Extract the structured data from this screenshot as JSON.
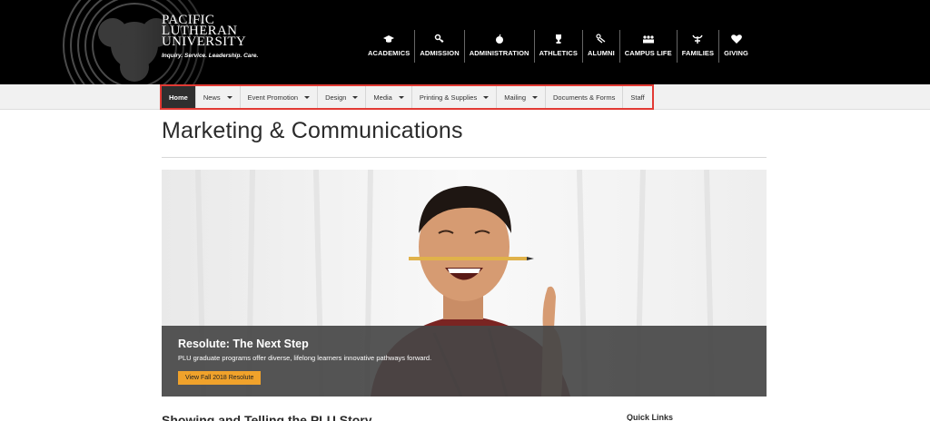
{
  "header": {
    "logo_lines": [
      "PACIFIC",
      "LUTHERAN",
      "UNIVERSITY"
    ],
    "tagline": "Inquiry. Service. Leadership. Care.",
    "nav": [
      {
        "label": "ACADEMICS",
        "icon": "graduation-cap-icon"
      },
      {
        "label": "ADMISSION",
        "icon": "key-icon"
      },
      {
        "label": "ADMINISTRATION",
        "icon": "apple-icon"
      },
      {
        "label": "ATHLETICS",
        "icon": "trophy-icon"
      },
      {
        "label": "ALUMNI",
        "icon": "handshake-icon"
      },
      {
        "label": "CAMPUS LIFE",
        "icon": "people-icon"
      },
      {
        "label": "FAMILIES",
        "icon": "family-icon"
      },
      {
        "label": "GIVING",
        "icon": "heart-icon"
      }
    ]
  },
  "subnav": [
    {
      "label": "Home",
      "dropdown": false,
      "active": true
    },
    {
      "label": "News",
      "dropdown": true,
      "active": false
    },
    {
      "label": "Event Promotion",
      "dropdown": true,
      "active": false
    },
    {
      "label": "Design",
      "dropdown": true,
      "active": false
    },
    {
      "label": "Media",
      "dropdown": true,
      "active": false
    },
    {
      "label": "Printing & Supplies",
      "dropdown": true,
      "active": false
    },
    {
      "label": "Mailing",
      "dropdown": true,
      "active": false
    },
    {
      "label": "Documents & Forms",
      "dropdown": false,
      "active": false
    },
    {
      "label": "Staff",
      "dropdown": false,
      "active": false
    }
  ],
  "main": {
    "title": "Marketing & Communications",
    "hero": {
      "title": "Resolute: The Next Step",
      "subtitle": "PLU graduate programs offer diverse, lifelong learners innovative pathways forward.",
      "button": "View Fall 2018 Resolute"
    },
    "section_heading": "Showing and Telling the PLU Story",
    "sidebar_heading": "Quick Links"
  },
  "colors": {
    "header_bg": "#000000",
    "highlight": "#e23a34",
    "button": "#f0a22b",
    "active_tab": "#2f2f2f"
  }
}
